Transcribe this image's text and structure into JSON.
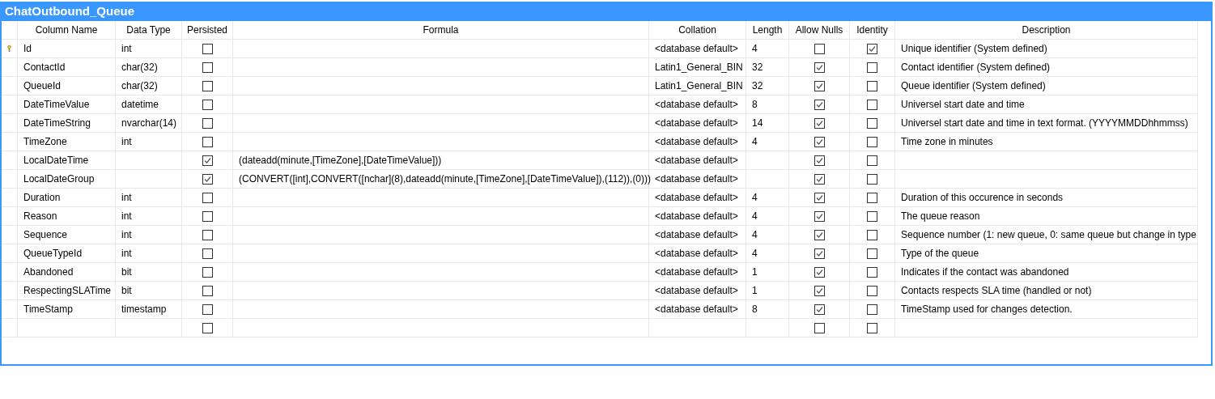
{
  "window": {
    "title": "ChatOutbound_Queue"
  },
  "table": {
    "columns": [
      "Column Name",
      "Data Type",
      "Persisted",
      "Formula",
      "Collation",
      "Length",
      "Allow Nulls",
      "Identity",
      "Description"
    ],
    "rows": [
      {
        "primary_key": true,
        "name": "Id",
        "data_type": "int",
        "persisted": false,
        "collation": "<database default>",
        "length": "4",
        "allow_nulls": false,
        "identity": true,
        "description": "Unique identifier (System defined)"
      },
      {
        "primary_key": false,
        "name": "ContactId",
        "data_type": "char(32)",
        "persisted": false,
        "collation": "Latin1_General_BIN",
        "length": "32",
        "allow_nulls": true,
        "identity": false,
        "description": "Contact identifier (System defined)"
      },
      {
        "primary_key": false,
        "name": "QueueId",
        "data_type": "char(32)",
        "persisted": false,
        "collation": "Latin1_General_BIN",
        "length": "32",
        "allow_nulls": true,
        "identity": false,
        "description": "Queue identifier (System defined)"
      },
      {
        "primary_key": false,
        "name": "DateTimeValue",
        "data_type": "datetime",
        "persisted": false,
        "collation": "<database default>",
        "length": "8",
        "allow_nulls": true,
        "identity": false,
        "description": "Universel start date and time"
      },
      {
        "primary_key": false,
        "name": "DateTimeString",
        "data_type": "nvarchar(14)",
        "persisted": false,
        "collation": "<database default>",
        "length": "14",
        "allow_nulls": true,
        "identity": false,
        "description": "Universel start date and time in text format. (YYYYMMDDhhmmss)"
      },
      {
        "primary_key": false,
        "name": "TimeZone",
        "data_type": "int",
        "persisted": false,
        "collation": "<database default>",
        "length": "4",
        "allow_nulls": true,
        "identity": false,
        "description": "Time zone in minutes"
      },
      {
        "primary_key": false,
        "name": "LocalDateTime",
        "persisted": true,
        "formula": "(dateadd(minute,[TimeZone],[DateTimeValue]))",
        "collation": "<database default>",
        "allow_nulls": true,
        "identity": false
      },
      {
        "primary_key": false,
        "name": "LocalDateGroup",
        "persisted": true,
        "formula": "(CONVERT([int],CONVERT([nchar](8),dateadd(minute,[TimeZone],[DateTimeValue]),(112)),(0)))",
        "collation": "<database default>",
        "allow_nulls": true,
        "identity": false
      },
      {
        "primary_key": false,
        "name": "Duration",
        "data_type": "int",
        "persisted": false,
        "collation": "<database default>",
        "length": "4",
        "allow_nulls": true,
        "identity": false,
        "description": "Duration of this occurence in seconds"
      },
      {
        "primary_key": false,
        "name": "Reason",
        "data_type": "int",
        "persisted": false,
        "collation": "<database default>",
        "length": "4",
        "allow_nulls": true,
        "identity": false,
        "description": "The queue reason"
      },
      {
        "primary_key": false,
        "name": "Sequence",
        "data_type": "int",
        "persisted": false,
        "collation": "<database default>",
        "length": "4",
        "allow_nulls": true,
        "identity": false,
        "description": "Sequence number (1: new queue, 0: same queue but change in type"
      },
      {
        "primary_key": false,
        "name": "QueueTypeId",
        "data_type": "int",
        "persisted": false,
        "collation": "<database default>",
        "length": "4",
        "allow_nulls": true,
        "identity": false,
        "description": "Type of the queue"
      },
      {
        "primary_key": false,
        "name": "Abandoned",
        "data_type": "bit",
        "persisted": false,
        "collation": "<database default>",
        "length": "1",
        "allow_nulls": true,
        "identity": false,
        "description": "Indicates if the contact was abandoned"
      },
      {
        "primary_key": false,
        "name": "RespectingSLATime",
        "data_type": "bit",
        "persisted": false,
        "collation": "<database default>",
        "length": "1",
        "allow_nulls": true,
        "identity": false,
        "description": "Contacts respects SLA time (handled or not)"
      },
      {
        "primary_key": false,
        "name": "TimeStamp",
        "data_type": "timestamp",
        "persisted": false,
        "collation": "<database default>",
        "length": "8",
        "allow_nulls": true,
        "identity": false,
        "description": "TimeStamp used for changes detection."
      },
      {
        "primary_key": false,
        "persisted": false,
        "allow_nulls": false,
        "identity": false
      }
    ]
  }
}
